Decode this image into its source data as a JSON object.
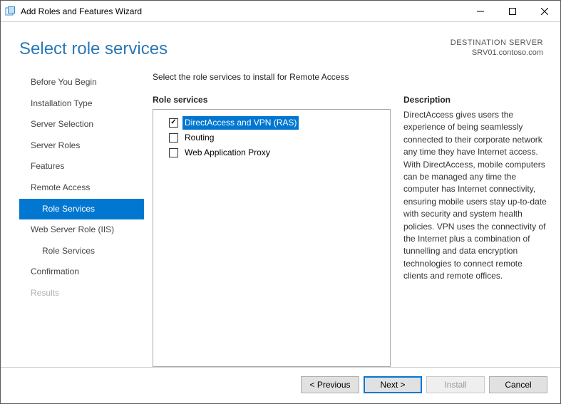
{
  "window": {
    "title": "Add Roles and Features Wizard"
  },
  "header": {
    "page_title": "Select role services",
    "destination_label": "DESTINATION SERVER",
    "destination_value": "SRV01.contoso.com"
  },
  "nav": {
    "items": [
      {
        "label": "Before You Begin",
        "selected": false,
        "disabled": false,
        "indent": 0
      },
      {
        "label": "Installation Type",
        "selected": false,
        "disabled": false,
        "indent": 0
      },
      {
        "label": "Server Selection",
        "selected": false,
        "disabled": false,
        "indent": 0
      },
      {
        "label": "Server Roles",
        "selected": false,
        "disabled": false,
        "indent": 0
      },
      {
        "label": "Features",
        "selected": false,
        "disabled": false,
        "indent": 0
      },
      {
        "label": "Remote Access",
        "selected": false,
        "disabled": false,
        "indent": 0
      },
      {
        "label": "Role Services",
        "selected": true,
        "disabled": false,
        "indent": 1
      },
      {
        "label": "Web Server Role (IIS)",
        "selected": false,
        "disabled": false,
        "indent": 0
      },
      {
        "label": "Role Services",
        "selected": false,
        "disabled": false,
        "indent": 1
      },
      {
        "label": "Confirmation",
        "selected": false,
        "disabled": false,
        "indent": 0
      },
      {
        "label": "Results",
        "selected": false,
        "disabled": true,
        "indent": 0
      }
    ]
  },
  "main": {
    "instruction": "Select the role services to install for Remote Access",
    "role_services_label": "Role services",
    "description_label": "Description",
    "tree": [
      {
        "label": "DirectAccess and VPN (RAS)",
        "checked": true,
        "selected": true
      },
      {
        "label": "Routing",
        "checked": false,
        "selected": false
      },
      {
        "label": "Web Application Proxy",
        "checked": false,
        "selected": false
      }
    ],
    "description": "DirectAccess gives users the experience of being seamlessly connected to their corporate network any time they have Internet access. With DirectAccess, mobile computers can be managed any time the computer has Internet connectivity, ensuring mobile users stay up-to-date with security and system health policies. VPN uses the connectivity of the Internet plus a combination of tunnelling and data encryption technologies to connect remote clients and remote offices."
  },
  "footer": {
    "previous": "< Previous",
    "next": "Next >",
    "install": "Install",
    "cancel": "Cancel"
  }
}
